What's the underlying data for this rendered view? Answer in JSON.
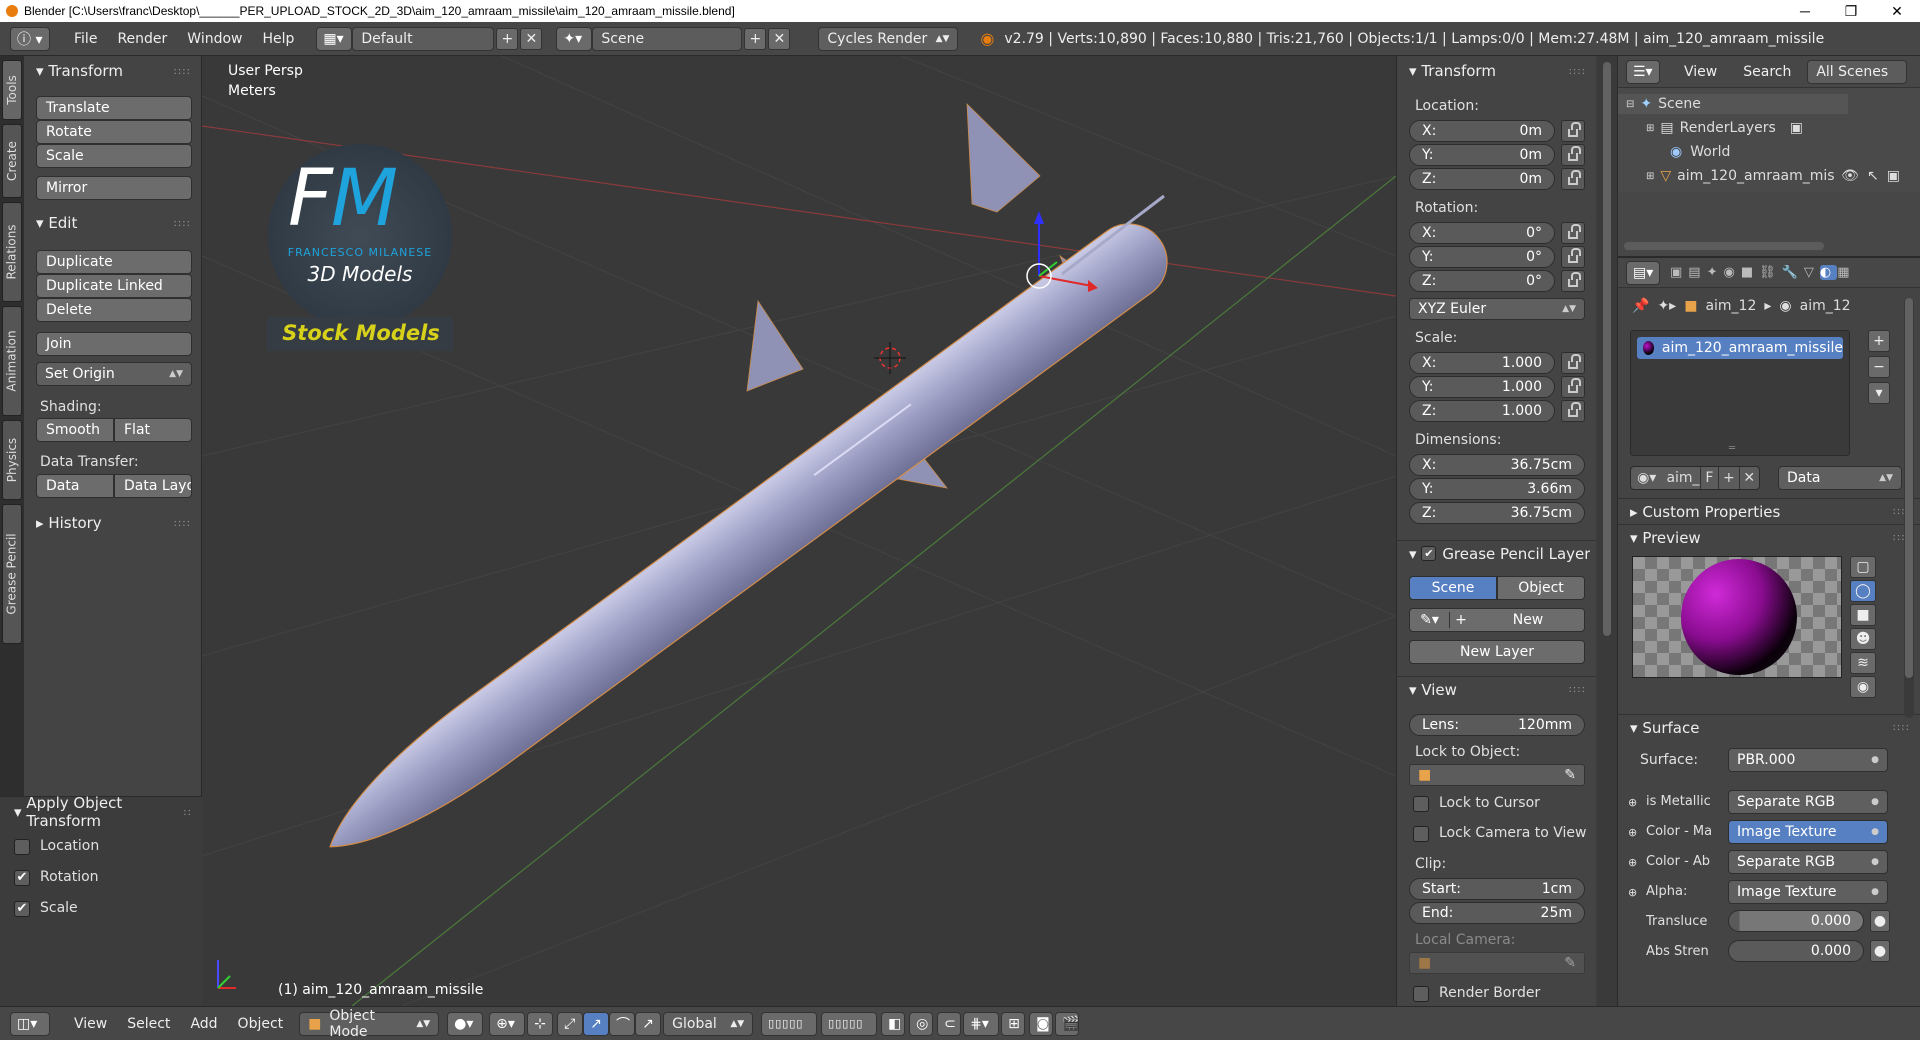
{
  "window": {
    "title": "Blender [C:\\Users\\franc\\Desktop\\______PER_UPLOAD_STOCK_2D_3D\\aim_120_amraam_missile\\aim_120_amraam_missile.blend]",
    "minimize": "─",
    "maximize": "❐",
    "close": "✕"
  },
  "infobar": {
    "menus": [
      "File",
      "Render",
      "Window",
      "Help"
    ],
    "layout": "Default",
    "scene": "Scene",
    "engine": "Cycles Render",
    "stats": "v2.79 | Verts:10,890 | Faces:10,880 | Tris:21,760 | Objects:1/1 | Lamps:0/0 | Mem:27.48M | aim_120_amraam_missile"
  },
  "vtabs": [
    "Tools",
    "Create",
    "Relations",
    "Animation",
    "Physics",
    "Grease Pencil"
  ],
  "toolshelf": {
    "transform": {
      "title": "Transform",
      "buttons": [
        "Translate",
        "Rotate",
        "Scale",
        "Mirror"
      ]
    },
    "edit": {
      "title": "Edit",
      "buttons": [
        "Duplicate",
        "Duplicate Linked",
        "Delete",
        "Join"
      ],
      "set_origin": "Set Origin",
      "shading_label": "Shading:",
      "smooth": "Smooth",
      "flat": "Flat",
      "data_transfer_label": "Data Transfer:",
      "data": "Data",
      "data_layout": "Data Layo"
    },
    "history": {
      "title": "History"
    }
  },
  "operator": {
    "title": "Apply Object Transform",
    "options": [
      {
        "label": "Location",
        "checked": false
      },
      {
        "label": "Rotation",
        "checked": true
      },
      {
        "label": "Scale",
        "checked": true
      }
    ]
  },
  "viewport": {
    "view_name": "User Persp",
    "units": "Meters",
    "object_label": "(1) aim_120_amraam_missile",
    "logo": {
      "initials_f": "F",
      "initials_m": "M",
      "brand": "FRANCESCO MILANESE",
      "sub": "3D Models",
      "stock": "Stock Models"
    }
  },
  "npanel": {
    "transform_title": "Transform",
    "location_label": "Location:",
    "location": [
      {
        "k": "X:",
        "v": "0m"
      },
      {
        "k": "Y:",
        "v": "0m"
      },
      {
        "k": "Z:",
        "v": "0m"
      }
    ],
    "rotation_label": "Rotation:",
    "rotation": [
      {
        "k": "X:",
        "v": "0°"
      },
      {
        "k": "Y:",
        "v": "0°"
      },
      {
        "k": "Z:",
        "v": "0°"
      }
    ],
    "rotation_mode": "XYZ Euler",
    "scale_label": "Scale:",
    "scale": [
      {
        "k": "X:",
        "v": "1.000"
      },
      {
        "k": "Y:",
        "v": "1.000"
      },
      {
        "k": "Z:",
        "v": "1.000"
      }
    ],
    "dimensions_label": "Dimensions:",
    "dimensions": [
      {
        "k": "X:",
        "v": "36.75cm"
      },
      {
        "k": "Y:",
        "v": "3.66m"
      },
      {
        "k": "Z:",
        "v": "36.75cm"
      }
    ],
    "gp_title": "Grease Pencil Layer",
    "gp_scene": "Scene",
    "gp_object": "Object",
    "gp_new": "New",
    "gp_new_layer": "New Layer",
    "view_title": "View",
    "lens_k": "Lens:",
    "lens_v": "120mm",
    "lock_obj_label": "Lock to Object:",
    "lock_cursor": "Lock to Cursor",
    "lock_camera": "Lock Camera to View",
    "clip_label": "Clip:",
    "clip_start_k": "Start:",
    "clip_start_v": "1cm",
    "clip_end_k": "End:",
    "clip_end_v": "25m",
    "local_camera": "Local Camera:",
    "render_border": "Render Border"
  },
  "outliner": {
    "menus": [
      "View",
      "Search"
    ],
    "filter": "All Scenes",
    "items": [
      "Scene",
      "RenderLayers",
      "World",
      "aim_120_amraam_mis"
    ]
  },
  "props": {
    "breadcrumb": [
      "aim_12",
      "aim_12"
    ],
    "material": "aim_120_amraam_missile",
    "mat_name": "aim_",
    "mat_f": "F",
    "data_dd": "Data",
    "custom_props": "Custom Properties",
    "preview": "Preview",
    "surface_title": "Surface",
    "surface_label": "Surface:",
    "surface_value": "PBR.000",
    "inputs": [
      {
        "k": "is Metallic",
        "v": "Separate RGB"
      },
      {
        "k": "Color - Ma",
        "v": "Image Texture"
      },
      {
        "k": "Color - Ab",
        "v": "Separate RGB"
      },
      {
        "k": "Alpha:",
        "v": "Image Texture"
      }
    ],
    "translucency_k": "Transluce",
    "translucency_v": "0.000",
    "abs_k": "Abs Stren",
    "abs_v": "0.000"
  },
  "statusbar": {
    "menus": [
      "View",
      "Select",
      "Add",
      "Object"
    ],
    "mode": "Object Mode",
    "orientation": "Global"
  },
  "colors": {
    "accent": "#5680c2",
    "viewport_bg": "#393939",
    "missile": "#9a9cc0",
    "logo_blue": "#1fa3dc",
    "logo_yellow": "#d8d11a"
  }
}
